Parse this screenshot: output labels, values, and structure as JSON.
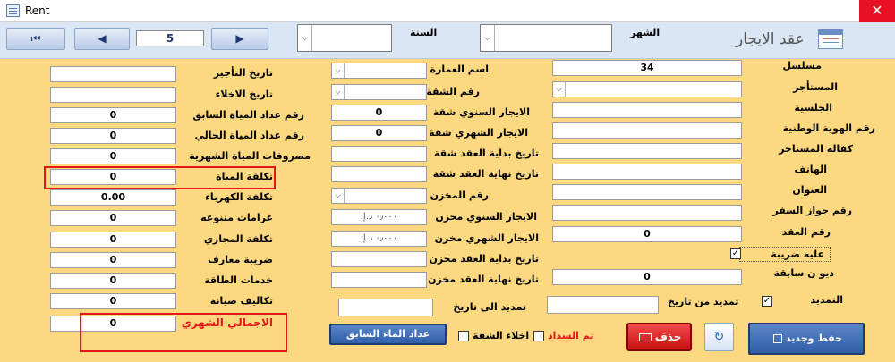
{
  "window": {
    "title": "Rent",
    "close": "✕"
  },
  "header": {
    "first": "⏮",
    "prev": "◀",
    "record": "5",
    "next": "▶",
    "year_label": "السنة",
    "month_label": "الشهر",
    "form_title": "عقد الايجار"
  },
  "col1": {
    "serial_label": "مسلسل",
    "serial_value": "34",
    "tenant_label": "المستأجر",
    "nationality_label": "الجلسية",
    "id_label": "رقم الهوية الوطنية",
    "guarantee_label": "كفالة المستاجر",
    "phone_label": "الهاتف",
    "address_label": "العنوان",
    "passport_label": "رقم جواز السفر",
    "contract_no_label": "رقم العقد",
    "contract_no_value": "0",
    "tax_label": "عليه ضريبة",
    "prior_debt_label": "ديو ن سابقة",
    "prior_debt_value": "0",
    "renewal_label": "التمديد",
    "renew_from_label": "تمديد من تاريخ"
  },
  "col2": {
    "building_label": "اسم العمارة",
    "apartment_no_label": "رقم الشقة",
    "annual_rent_label": "الايجار السنوي شقة",
    "annual_rent_value": "0",
    "monthly_rent_label": "الايجار الشهري شقة",
    "monthly_rent_value": "0",
    "start_apt_label": "تاريخ بداية العقد شقة",
    "end_apt_label": "تاريخ نهاية العقد شقة",
    "store_no_label": "رقم المخزن",
    "store_annual_label": "الايجار السنوي مخزن",
    "store_annual_value": "٠٫٠٠٠ د.إ.‏",
    "store_monthly_label": "الايجار الشهري مخزن",
    "store_monthly_value": "٠٫٠٠٠ د.إ.‏",
    "store_start_label": "تاريخ بداية العقد مخزن",
    "store_end_label": "تاريخ نهاية العقد مخزن",
    "renew_to_label": "تمديد الى تاريخ"
  },
  "col3": {
    "rent_date_label": "تاريخ التأجير",
    "vacate_date_label": "تاريخ الاخلاء",
    "prev_water_label": "رقم عداد المياة السابق",
    "prev_water_value": "0",
    "cur_water_label": "رقم عداد المياة الحالي",
    "cur_water_value": "0",
    "monthly_water_label": "مصروفات المياة الشهرية",
    "monthly_water_value": "0",
    "water_cost_label": "تكلفة المياة",
    "water_cost_value": "0",
    "electric_label": "تكلفة الكهرباء",
    "electric_value": "0.00",
    "fines_label": "غرامات متنوعه",
    "fines_value": "0",
    "sewage_label": "تكلفة المجاري",
    "sewage_value": "0",
    "maaref_label": "ضريبة معارف",
    "maaref_value": "0",
    "energy_label": "خدمات الطاقة",
    "energy_value": "0",
    "maintenance_label": "تكاليف صيانة",
    "maintenance_value": "0",
    "total_label": "الاجمالي الشهري",
    "total_value": "0"
  },
  "footer": {
    "save_new": "حفظ وجديد",
    "refresh": "↻",
    "delete": "حذف",
    "paid_label": "تم السداد",
    "vacate_apt_label": "اخلاء الشقة",
    "prev_water_btn": "عداد الماء السابق"
  }
}
